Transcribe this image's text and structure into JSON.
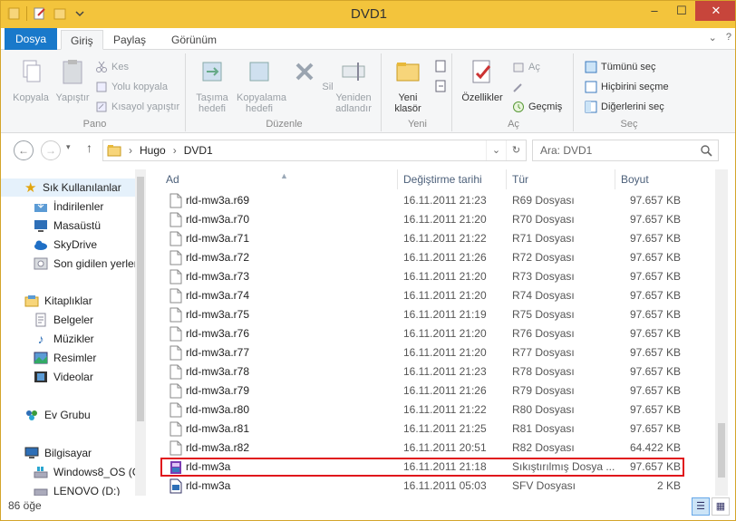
{
  "window": {
    "title": "DVD1",
    "minimize": "‒",
    "maximize": "☐",
    "close": "✕"
  },
  "tabs": {
    "file": "Dosya",
    "home": "Giriş",
    "share": "Paylaş",
    "view": "Görünüm"
  },
  "ribbon": {
    "clipboard": {
      "label": "Pano",
      "copy": "Kopyala",
      "paste": "Yapıştır",
      "cut": "Kes",
      "copy_path": "Yolu kopyala",
      "paste_shortcut": "Kısayol yapıştır"
    },
    "organize": {
      "label": "Düzenle",
      "move_to": "Taşıma hedefi",
      "copy_to": "Kopyalama hedefi",
      "delete": "Sil",
      "rename": "Yeniden adlandır"
    },
    "new": {
      "label": "Yeni",
      "new_folder": "Yeni klasör"
    },
    "open": {
      "label": "Aç",
      "properties": "Özellikler",
      "open": "Aç",
      "history": "Geçmiş"
    },
    "select": {
      "label": "Seç",
      "select_all": "Tümünü seç",
      "select_none": "Hiçbirini seçme",
      "invert": "Diğerlerini seç"
    }
  },
  "address": {
    "path": [
      "Hugo",
      "DVD1"
    ],
    "search_placeholder": "Ara: DVD1"
  },
  "nav": {
    "favorites": "Sık Kullanılanlar",
    "downloads": "İndirilenler",
    "desktop": "Masaüstü",
    "skydrive": "SkyDrive",
    "recent": "Son gidilen yerler",
    "libraries": "Kitaplıklar",
    "documents": "Belgeler",
    "music": "Müzikler",
    "pictures": "Resimler",
    "videos": "Videolar",
    "homegroup": "Ev Grubu",
    "computer": "Bilgisayar",
    "drive_c": "Windows8_OS (C",
    "drive_d": "LENOVO (D:)"
  },
  "columns": {
    "name": "Ad",
    "date": "Değiştirme tarihi",
    "type": "Tür",
    "size": "Boyut"
  },
  "files": [
    {
      "name": "rld-mw3a.r69",
      "date": "16.11.2011 21:23",
      "type": "R69 Dosyası",
      "size": "97.657 KB",
      "icon": "file-icon"
    },
    {
      "name": "rld-mw3a.r70",
      "date": "16.11.2011 21:20",
      "type": "R70 Dosyası",
      "size": "97.657 KB",
      "icon": "file-icon"
    },
    {
      "name": "rld-mw3a.r71",
      "date": "16.11.2011 21:22",
      "type": "R71 Dosyası",
      "size": "97.657 KB",
      "icon": "file-icon"
    },
    {
      "name": "rld-mw3a.r72",
      "date": "16.11.2011 21:26",
      "type": "R72 Dosyası",
      "size": "97.657 KB",
      "icon": "file-icon"
    },
    {
      "name": "rld-mw3a.r73",
      "date": "16.11.2011 21:20",
      "type": "R73 Dosyası",
      "size": "97.657 KB",
      "icon": "file-icon"
    },
    {
      "name": "rld-mw3a.r74",
      "date": "16.11.2011 21:20",
      "type": "R74 Dosyası",
      "size": "97.657 KB",
      "icon": "file-icon"
    },
    {
      "name": "rld-mw3a.r75",
      "date": "16.11.2011 21:19",
      "type": "R75 Dosyası",
      "size": "97.657 KB",
      "icon": "file-icon"
    },
    {
      "name": "rld-mw3a.r76",
      "date": "16.11.2011 21:20",
      "type": "R76 Dosyası",
      "size": "97.657 KB",
      "icon": "file-icon"
    },
    {
      "name": "rld-mw3a.r77",
      "date": "16.11.2011 21:20",
      "type": "R77 Dosyası",
      "size": "97.657 KB",
      "icon": "file-icon"
    },
    {
      "name": "rld-mw3a.r78",
      "date": "16.11.2011 21:23",
      "type": "R78 Dosyası",
      "size": "97.657 KB",
      "icon": "file-icon"
    },
    {
      "name": "rld-mw3a.r79",
      "date": "16.11.2011 21:26",
      "type": "R79 Dosyası",
      "size": "97.657 KB",
      "icon": "file-icon"
    },
    {
      "name": "rld-mw3a.r80",
      "date": "16.11.2011 21:22",
      "type": "R80 Dosyası",
      "size": "97.657 KB",
      "icon": "file-icon"
    },
    {
      "name": "rld-mw3a.r81",
      "date": "16.11.2011 21:25",
      "type": "R81 Dosyası",
      "size": "97.657 KB",
      "icon": "file-icon"
    },
    {
      "name": "rld-mw3a.r82",
      "date": "16.11.2011 20:51",
      "type": "R82 Dosyası",
      "size": "64.422 KB",
      "icon": "file-icon"
    },
    {
      "name": "rld-mw3a",
      "date": "16.11.2011 21:18",
      "type": "Sıkıştırılmış Dosya ...",
      "size": "97.657 KB",
      "icon": "rar-archive-icon"
    },
    {
      "name": "rld-mw3a",
      "date": "16.11.2011 05:03",
      "type": "SFV Dosyası",
      "size": "2 KB",
      "icon": "sfv-file-icon"
    }
  ],
  "status": {
    "count": "86 öğe"
  },
  "colors": {
    "accent": "#1979ca",
    "titlebar": "#f3c43c",
    "highlight": "#e0161c"
  }
}
